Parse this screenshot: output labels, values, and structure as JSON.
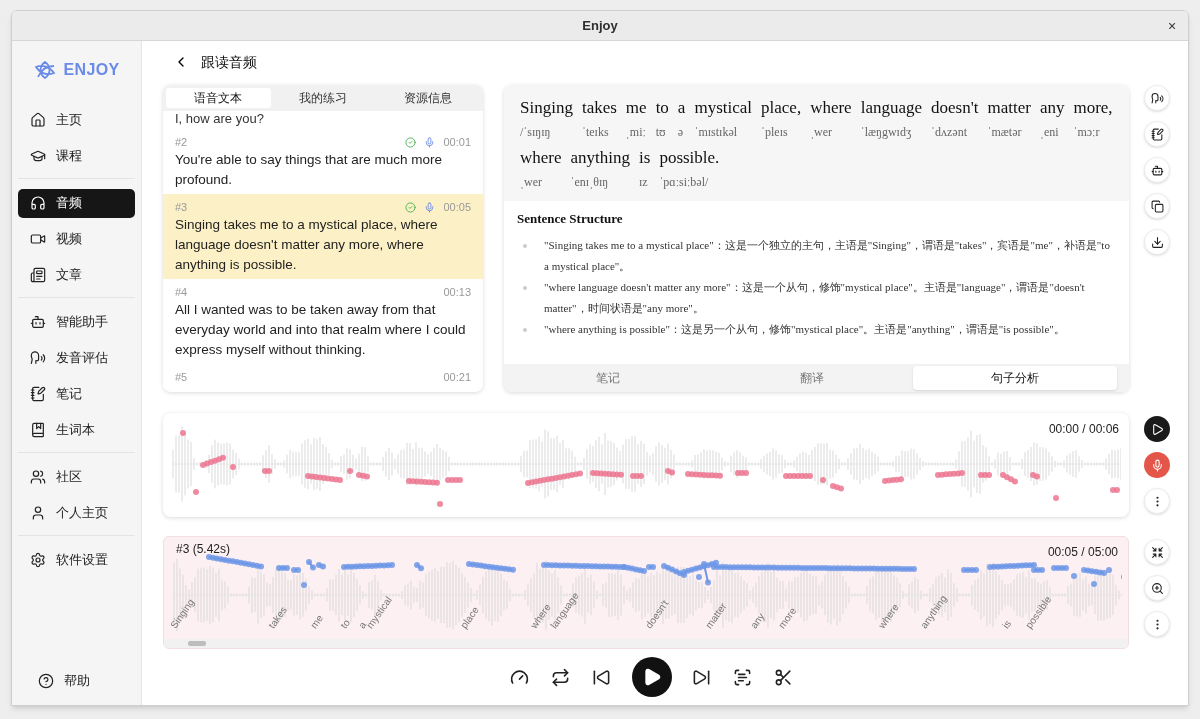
{
  "window": {
    "title": "Enjoy",
    "close": "×"
  },
  "sidebar": {
    "logo": "ENJOY",
    "groups": [
      [
        {
          "label": "主页",
          "selected": false
        },
        {
          "label": "课程",
          "selected": false
        }
      ],
      [
        {
          "label": "音频",
          "selected": true
        },
        {
          "label": "视频",
          "selected": false
        },
        {
          "label": "文章",
          "selected": false
        }
      ],
      [
        {
          "label": "智能助手",
          "selected": false
        },
        {
          "label": "发音评估",
          "selected": false
        },
        {
          "label": "笔记",
          "selected": false
        },
        {
          "label": "生词本",
          "selected": false
        }
      ],
      [
        {
          "label": "社区",
          "selected": false
        },
        {
          "label": "个人主页",
          "selected": false
        }
      ],
      [
        {
          "label": "软件设置",
          "selected": false
        }
      ]
    ],
    "help": "帮助"
  },
  "page_title": "跟读音频",
  "transcript": {
    "tabs": [
      {
        "label": "语音文本",
        "selected": true
      },
      {
        "label": "我的练习",
        "selected": false
      },
      {
        "label": "资源信息",
        "selected": false
      }
    ],
    "partial_text": "I, how are you?",
    "rows": [
      {
        "index": "#2",
        "time": "00:01",
        "assessed": true,
        "recorded": true,
        "selected": false,
        "text": "You're able to say things that are much more profound."
      },
      {
        "index": "#3",
        "time": "00:05",
        "assessed": true,
        "recorded": true,
        "selected": true,
        "text": "Singing takes me to a mystical place, where language doesn't matter any more, where anything is possible."
      },
      {
        "index": "#4",
        "time": "00:13",
        "assessed": false,
        "recorded": false,
        "selected": false,
        "text": "All I wanted was to be taken away from that everyday world and into that realm where I could express myself without thinking."
      },
      {
        "index": "#5",
        "time": "00:21",
        "assessed": false,
        "recorded": false,
        "selected": false
      }
    ]
  },
  "sentence": {
    "lines": [
      [
        {
          "word": "Singing",
          "ipa": "/ˈsɪŋɪŋ"
        },
        {
          "word": "takes",
          "ipa": "ˈteɪks"
        },
        {
          "word": "me",
          "ipa": "ˌmiː"
        },
        {
          "word": "to",
          "ipa": "tʊ"
        },
        {
          "word": "a",
          "ipa": "ə"
        },
        {
          "word": "mystical",
          "ipa": "ˈmɪstɪkəl"
        },
        {
          "word": "place,",
          "ipa": "ˈpleɪs"
        },
        {
          "word": "where",
          "ipa": "ˌwer"
        },
        {
          "word": "language",
          "ipa": "ˈlæŋgwɪdʒ"
        },
        {
          "word": "doesn't",
          "ipa": "ˈdʌzənt"
        },
        {
          "word": "matter",
          "ipa": "ˈmætər"
        },
        {
          "word": "any",
          "ipa": "ˌeni"
        },
        {
          "word": "more,",
          "ipa": "ˈmɔːr"
        }
      ],
      [
        {
          "word": "where",
          "ipa": "ˌwer"
        },
        {
          "word": "anything",
          "ipa": "ˈenɪˌθɪŋ"
        },
        {
          "word": "is",
          "ipa": "ɪz"
        },
        {
          "word": "possible.",
          "ipa": "ˈpɑːsiːbəl/"
        }
      ]
    ],
    "analysis_title": "Sentence Structure",
    "analysis": [
      "\"Singing takes me to a mystical place\"：这是一个独立的主句，主语是\"Singing\"，谓语是\"takes\"，宾语是\"me\"，补语是\"to a mystical place\"。",
      "\"where language doesn't matter any more\"：这是一个从句，修饰\"mystical place\"。主语是\"language\"，谓语是\"doesn't matter\"，时间状语是\"any more\"。",
      "\"where anything is possible\"：这是另一个从句，修饰\"mystical place\"。主语是\"anything\"，谓语是\"is possible\"。"
    ],
    "tabs": [
      {
        "label": "笔记",
        "selected": false
      },
      {
        "label": "翻译",
        "selected": false
      },
      {
        "label": "句子分析",
        "selected": true
      }
    ]
  },
  "recording": {
    "time": "00:00 / 00:06"
  },
  "segment": {
    "label": "#3 (5.42s)",
    "time": "00:05 / 05:00",
    "words": [
      "Singing",
      "takes",
      "me",
      "to",
      "a",
      "mystical",
      "place",
      "where",
      "language",
      "doesn't",
      "matter",
      "any",
      "more",
      "where",
      "anything",
      "is",
      "possible"
    ]
  }
}
